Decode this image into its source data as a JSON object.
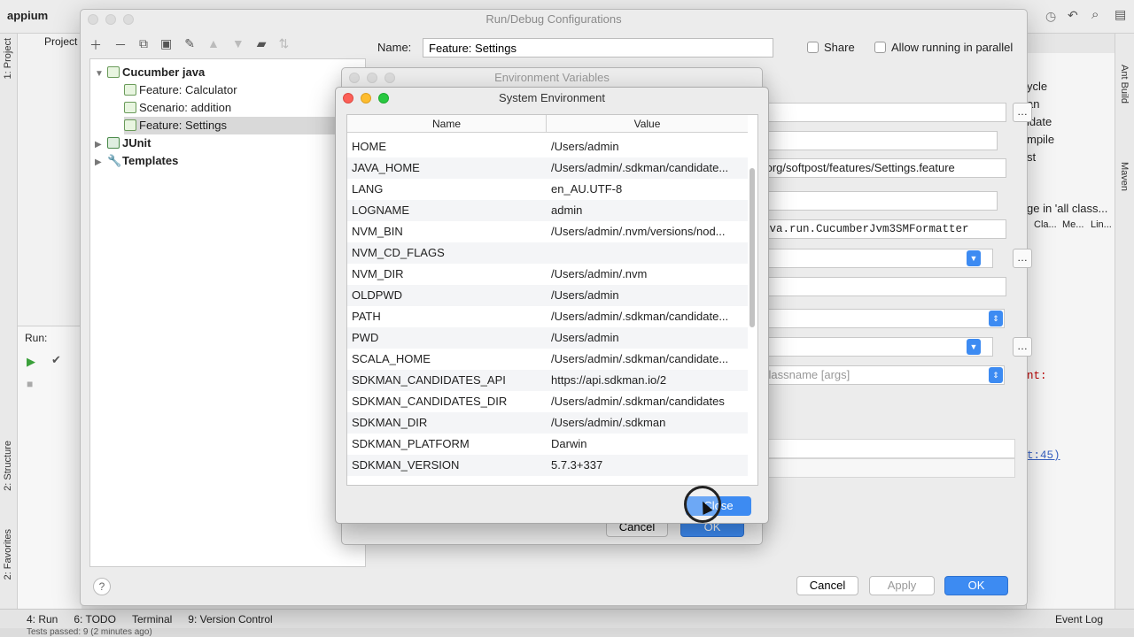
{
  "ide": {
    "project_label": "appium",
    "project_tab": "Project",
    "left_tabs": [
      "1: Project",
      "2: Structure",
      "2: Favorites"
    ],
    "right_tabs": [
      "Ant Build",
      "Maven"
    ],
    "run_label": "Run:",
    "bottom_tabs": [
      "4: Run",
      "6: TODO",
      "Terminal",
      "9: Version Control"
    ],
    "event_log": "Event Log",
    "status_text": "Tests passed: 9 (2 minutes ago)",
    "right_panel_items": [
      "ycle",
      "an",
      "idate",
      "mpile",
      "st"
    ],
    "right_panel_text": "ge in 'all class...",
    "right_panel_cols": [
      "Cla...",
      "Me...",
      "Lin..."
    ],
    "code_fragment": "nt:",
    "code_line": "t:45)"
  },
  "run_debug": {
    "title": "Run/Debug Configurations",
    "name_label": "Name:",
    "name_value": "Feature: Settings",
    "share_label": "Share",
    "parallel_label": "Allow running in parallel",
    "tree": [
      {
        "label": "Cucumber java",
        "level": 0,
        "bold": true,
        "expanded": true
      },
      {
        "label": "Feature: Calculator",
        "level": 1
      },
      {
        "label": "Scenario: addition",
        "level": 1
      },
      {
        "label": "Feature: Settings",
        "level": 1,
        "selected": true
      },
      {
        "label": "JUnit",
        "level": 0,
        "bold": true
      },
      {
        "label": "Templates",
        "level": 0,
        "bold": true
      }
    ],
    "feature_path": "/org/softpost/features/Settings.feature",
    "formatter": "ava.run.CucumberJvm3SMFormatter",
    "main_class_placeholder": "classname [args]",
    "cancel_label": "Cancel",
    "apply_label": "Apply",
    "ok_label": "OK",
    "help_label": "?"
  },
  "env_dialog": {
    "title": "Environment Variables",
    "cancel_label": "Cancel",
    "ok_label": "OK"
  },
  "system_env": {
    "title": "System Environment",
    "col_name": "Name",
    "col_value": "Value",
    "rows": [
      {
        "name": "HOME",
        "value": "/Users/admin"
      },
      {
        "name": "JAVA_HOME",
        "value": "/Users/admin/.sdkman/candidate..."
      },
      {
        "name": "LANG",
        "value": "en_AU.UTF-8"
      },
      {
        "name": "LOGNAME",
        "value": "admin"
      },
      {
        "name": "NVM_BIN",
        "value": "/Users/admin/.nvm/versions/nod..."
      },
      {
        "name": "NVM_CD_FLAGS",
        "value": ""
      },
      {
        "name": "NVM_DIR",
        "value": "/Users/admin/.nvm"
      },
      {
        "name": "OLDPWD",
        "value": "/Users/admin"
      },
      {
        "name": "PATH",
        "value": "/Users/admin/.sdkman/candidate..."
      },
      {
        "name": "PWD",
        "value": "/Users/admin"
      },
      {
        "name": "SCALA_HOME",
        "value": "/Users/admin/.sdkman/candidate..."
      },
      {
        "name": "SDKMAN_CANDIDATES_API",
        "value": "https://api.sdkman.io/2"
      },
      {
        "name": "SDKMAN_CANDIDATES_DIR",
        "value": "/Users/admin/.sdkman/candidates"
      },
      {
        "name": "SDKMAN_DIR",
        "value": "/Users/admin/.sdkman"
      },
      {
        "name": "SDKMAN_PLATFORM",
        "value": "Darwin"
      },
      {
        "name": "SDKMAN_VERSION",
        "value": "5.7.3+337"
      }
    ],
    "close_label": "Close"
  },
  "colors": {
    "accent": "#3d8bf2",
    "mac_red": "#fc5f57",
    "mac_yellow": "#fdbc2e",
    "mac_green": "#28c840"
  }
}
